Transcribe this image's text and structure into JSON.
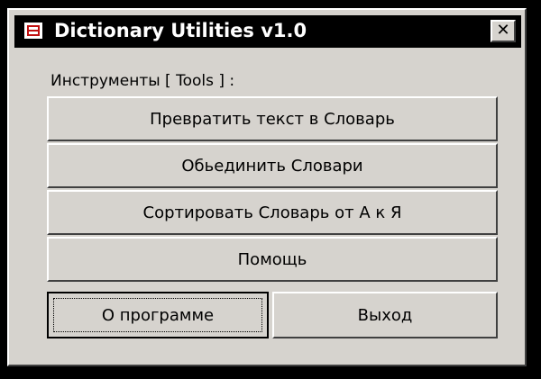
{
  "window": {
    "title": "Dictionary Utilities v1.0",
    "close_label": "✕"
  },
  "tools": {
    "label": "Инструменты [ Tools ] :",
    "buttons": [
      {
        "label": "Превратить текст в Словарь"
      },
      {
        "label": "Обьединить Словари"
      },
      {
        "label": "Сортировать Словарь от А к Я"
      },
      {
        "label": "Помощь"
      }
    ]
  },
  "footer": {
    "about_label": "О программе",
    "exit_label": "Выход"
  },
  "icons": {
    "app": "dictionary-app-icon",
    "close": "close-icon"
  },
  "colors": {
    "face": "#d6d3ce",
    "titlebar": "#000000",
    "icon_accent": "#c01010"
  }
}
